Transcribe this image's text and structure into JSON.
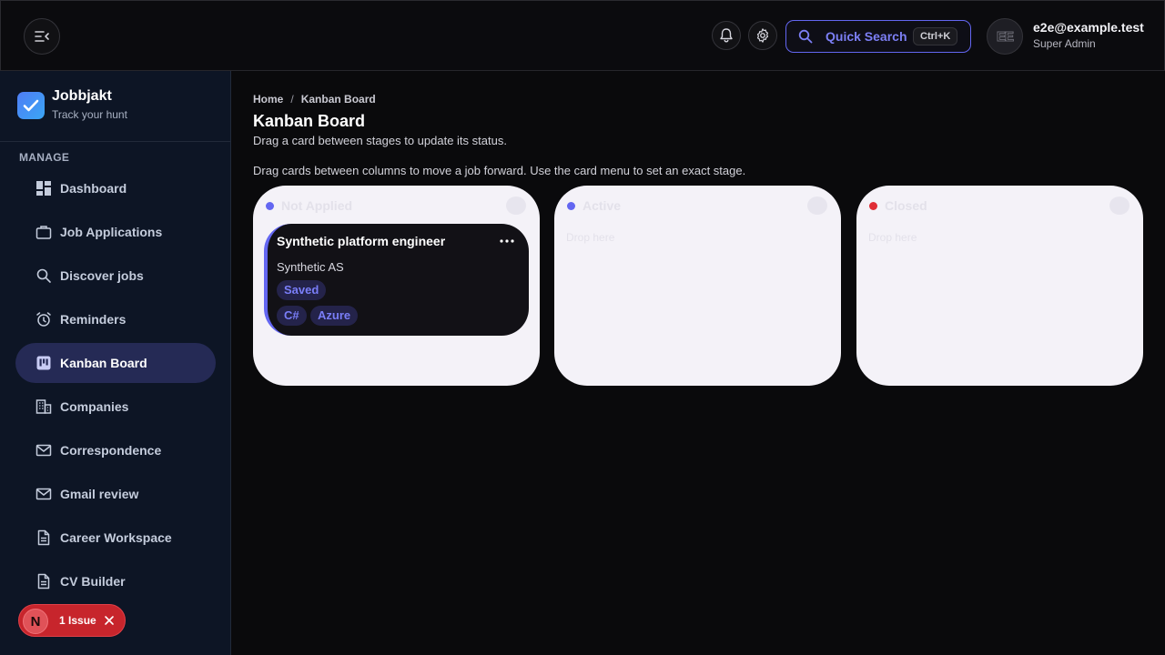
{
  "header": {
    "quick_search_label": "Quick Search",
    "quick_search_shortcut": "Ctrl+K",
    "user_initials": "EE",
    "user_email": "e2e@example.test",
    "user_role": "Super Admin"
  },
  "sidebar": {
    "brand_name": "Jobbjakt",
    "brand_tagline": "Track your hunt",
    "section_label": "MANAGE",
    "items": [
      {
        "label": "Dashboard",
        "icon": "dashboard-icon"
      },
      {
        "label": "Job Applications",
        "icon": "briefcase-icon"
      },
      {
        "label": "Discover jobs",
        "icon": "search-icon"
      },
      {
        "label": "Reminders",
        "icon": "alarm-clock-icon"
      },
      {
        "label": "Kanban Board",
        "icon": "kanban-icon",
        "active": true
      },
      {
        "label": "Companies",
        "icon": "building-icon"
      },
      {
        "label": "Correspondence",
        "icon": "mail-icon"
      },
      {
        "label": "Gmail review",
        "icon": "mail-icon"
      },
      {
        "label": "Career Workspace",
        "icon": "document-icon"
      },
      {
        "label": "CV Builder",
        "icon": "document-icon"
      }
    ]
  },
  "issue_badge": {
    "letter": "N",
    "label": "1 Issue"
  },
  "main": {
    "breadcrumb": [
      "Home",
      "Kanban Board"
    ],
    "breadcrumb_separator": "/",
    "title": "Kanban Board",
    "subtitle": "Drag a card between stages to update its status.",
    "hint": "Drag cards between columns to move a job forward. Use the card menu to set an exact stage.",
    "columns": [
      {
        "title": "Not Applied",
        "dot_color": "#6366f1"
      },
      {
        "title": "Active",
        "dot_color": "#6366f1",
        "empty_text": "Drop here"
      },
      {
        "title": "Closed",
        "dot_color": "#e02d36",
        "empty_text": "Drop here"
      }
    ],
    "card": {
      "title": "Synthetic platform engineer",
      "company": "Synthetic AS",
      "status": "Saved",
      "tags": [
        "C#",
        "Azure"
      ]
    }
  },
  "colors": {
    "accent": "#6366f1",
    "sidebar_bg": "#0d1525",
    "active_nav_bg": "#252a55",
    "issue_red": "#c7252c"
  }
}
